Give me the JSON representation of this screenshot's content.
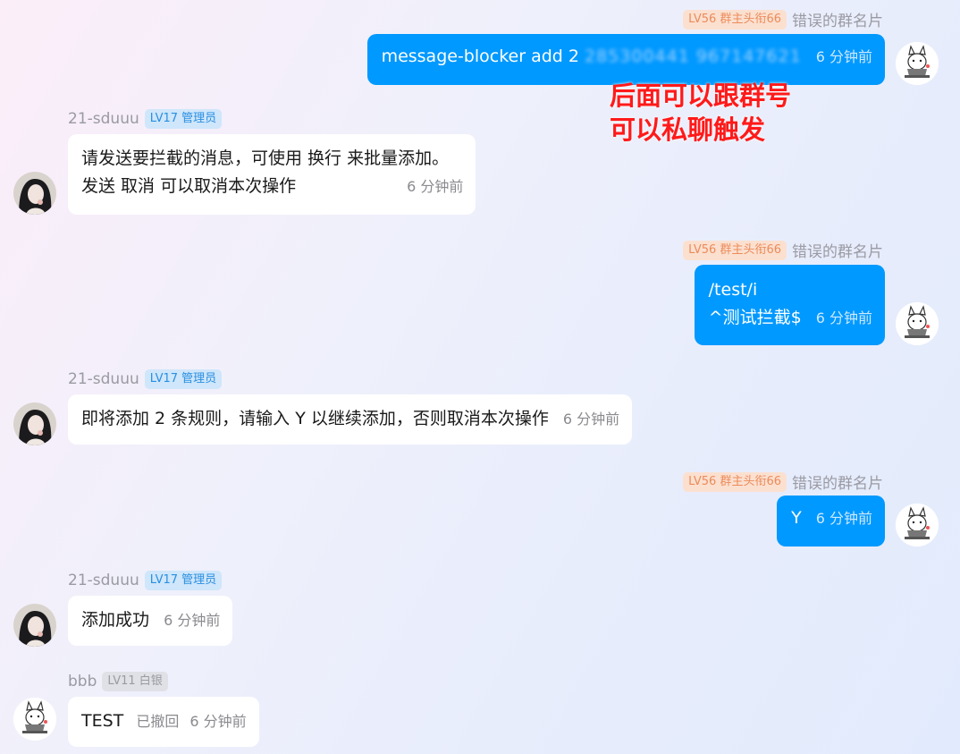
{
  "me": {
    "level_badge": "LV56 群主头衔66",
    "nickname": "错误的群名片"
  },
  "bot": {
    "nickname": "21-sduuu",
    "level_badge": "LV17 管理员"
  },
  "other": {
    "nickname": "bbb",
    "level_badge": "LV11 白银"
  },
  "messages": [
    {
      "text": "message-blocker add 2",
      "blurred": "285300441 967147621",
      "time": "6 分钟前"
    },
    {
      "line1": "请发送要拦截的消息，可使用 换行 来批量添加。",
      "line2": "发送 取消 可以取消本次操作",
      "time": "6 分钟前"
    },
    {
      "line1": "/test/i",
      "line2": "^测试拦截$",
      "time": "6 分钟前"
    },
    {
      "text": "即将添加 2 条规则，请输入 Y 以继续添加，否则取消本次操作",
      "time": "6 分钟前"
    },
    {
      "text": "Y",
      "time": "6 分钟前"
    },
    {
      "text": "添加成功",
      "time": "6 分钟前"
    },
    {
      "text": "TEST",
      "recalled": "已撤回",
      "time": "6 分钟前"
    }
  ],
  "annotation": {
    "line1": "后面可以跟群号",
    "line2": "可以私聊触发",
    "color": "#ff1a1a"
  },
  "colors": {
    "my_bubble": "#0099ff",
    "their_bubble": "#ffffff",
    "owner_badge_text": "#ec8b5a",
    "admin_badge_text": "#2a8fe0"
  }
}
